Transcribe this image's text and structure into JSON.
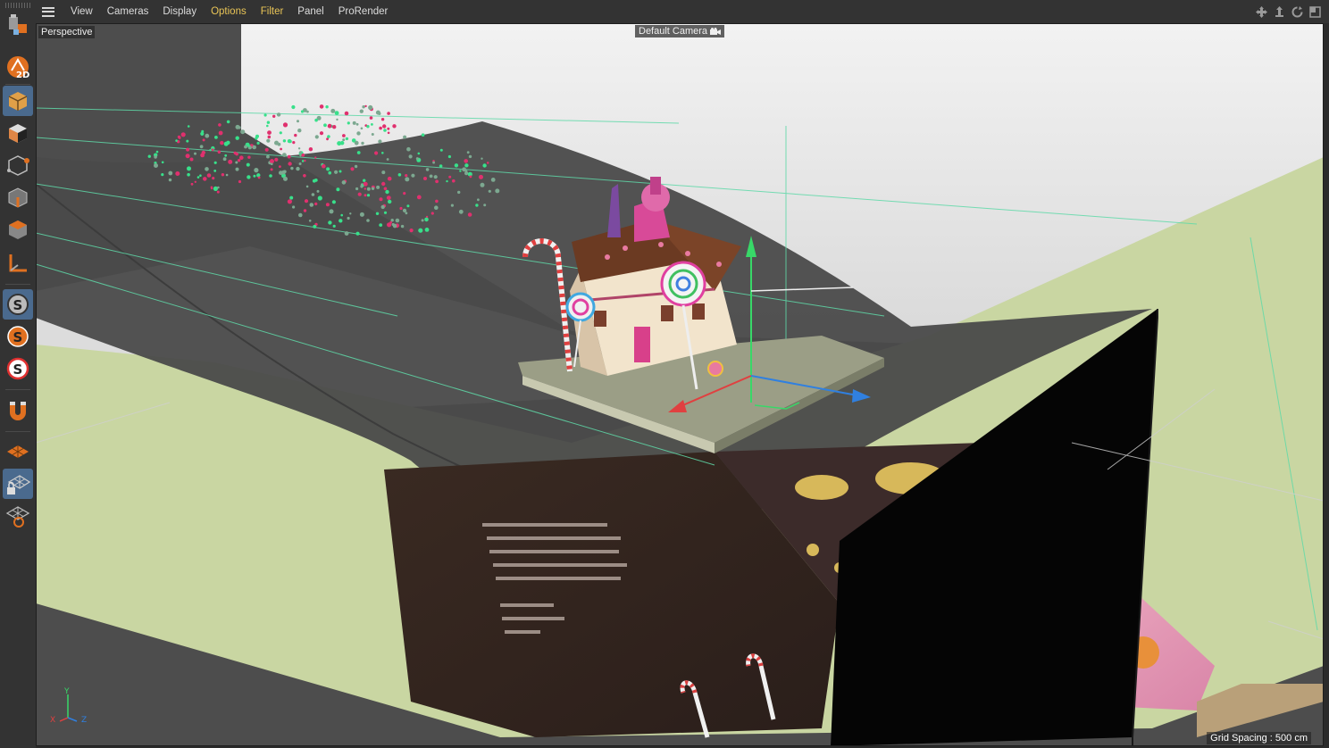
{
  "menu": {
    "items": [
      "View",
      "Cameras",
      "Display",
      "Options",
      "Filter",
      "Panel",
      "ProRender"
    ],
    "highlighted": [
      "Options",
      "Filter"
    ]
  },
  "viewport": {
    "view_name": "Perspective",
    "camera_name": "Default Camera",
    "grid_spacing": "Grid Spacing : 500 cm",
    "axis_labels": {
      "x": "X",
      "y": "Y",
      "z": "Z"
    }
  },
  "toolbar": {
    "tools": [
      {
        "name": "coordinate-system-icon",
        "active": false
      },
      {
        "name": "2d-snap-icon",
        "active": false
      },
      {
        "name": "model-mode-icon",
        "active": true
      },
      {
        "name": "texture-mode-icon",
        "active": false
      },
      {
        "name": "points-mode-icon",
        "active": false
      },
      {
        "name": "edges-mode-icon",
        "active": false
      },
      {
        "name": "polygons-mode-icon",
        "active": false
      },
      {
        "name": "axis-mode-icon",
        "active": false
      },
      {
        "name": "snap-icon",
        "active": true
      },
      {
        "name": "snap-settings-icon",
        "active": false
      },
      {
        "name": "snap-grid-icon",
        "active": false
      },
      {
        "name": "magnet-icon",
        "active": false
      },
      {
        "name": "workplane-icon",
        "active": false
      },
      {
        "name": "lock-workplane-icon",
        "active": true
      },
      {
        "name": "workplane-align-icon",
        "active": false
      }
    ]
  },
  "colors": {
    "menu_highlight": "#e8c456",
    "active_tool": "#4a6a8e",
    "wall": "#e8e8e8",
    "floor": "#c8d6a0",
    "spline": "#5fd9a8",
    "particle_green": "#38e08a",
    "particle_pink": "#e0306e"
  }
}
